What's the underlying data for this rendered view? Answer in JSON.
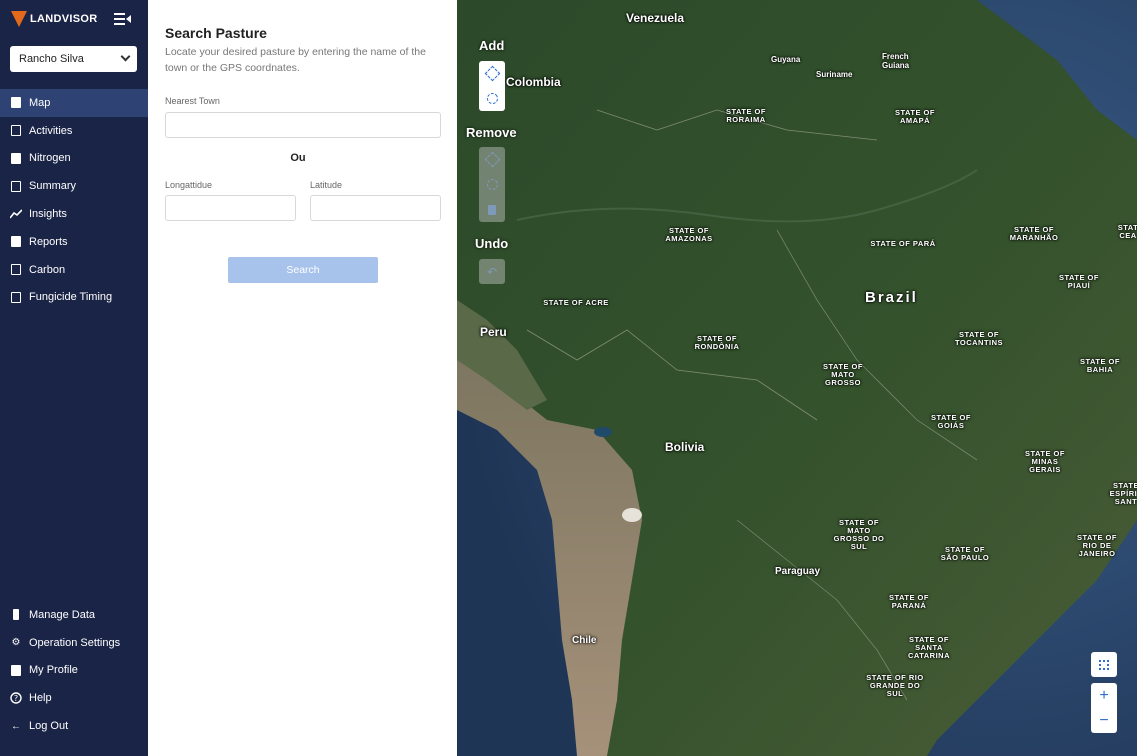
{
  "brand": {
    "name": "LANDVISOR"
  },
  "farm_select": {
    "value": "Rancho Silva"
  },
  "nav_top": [
    {
      "label": "Map",
      "icon": "map-icon",
      "active": true
    },
    {
      "label": "Activities",
      "icon": "activities-icon",
      "active": false
    },
    {
      "label": "Nitrogen",
      "icon": "nitrogen-icon",
      "active": false
    },
    {
      "label": "Summary",
      "icon": "summary-icon",
      "active": false
    },
    {
      "label": "Insights",
      "icon": "insights-icon",
      "active": false
    },
    {
      "label": "Reports",
      "icon": "reports-icon",
      "active": false
    },
    {
      "label": "Carbon",
      "icon": "carbon-icon",
      "active": false
    },
    {
      "label": "Fungicide Timing",
      "icon": "calendar-icon",
      "active": false
    }
  ],
  "nav_bottom": [
    {
      "label": "Manage Data",
      "icon": "data-icon"
    },
    {
      "label": "Operation Settings",
      "icon": "gear-icon"
    },
    {
      "label": "My Profile",
      "icon": "profile-icon"
    },
    {
      "label": "Help",
      "icon": "help-icon"
    },
    {
      "label": "Log Out",
      "icon": "logout-icon"
    }
  ],
  "panel": {
    "title": "Search Pasture",
    "description": "Locate your desired pasture by entering the name of the town or the GPS coordnates.",
    "nearest_town_label": "Nearest Town",
    "or_text": "Ou",
    "longitude_label": "Longattidue",
    "latitude_label": "Latitude",
    "search_label": "Search"
  },
  "map_tools": {
    "add_title": "Add",
    "remove_title": "Remove",
    "undo_title": "Undo"
  },
  "map_controls": {
    "zoom_in": "+",
    "zoom_out": "−"
  },
  "map_labels": {
    "venezuela": "Venezuela",
    "colombia": "Colombia",
    "guyana": "Guyana",
    "suriname": "Suriname",
    "french_guiana": "French Guiana",
    "peru": "Peru",
    "bolivia": "Bolivia",
    "brazil": "Brazil",
    "paraguay": "Paraguay",
    "chile": "Chile",
    "roraima": "STATE OF RORAIMA",
    "amapa": "STATE OF AMAPÁ",
    "amazonas": "STATE OF AMAZONAS",
    "para": "STATE OF PARÁ",
    "maranhao": "STATE OF MARANHÃO",
    "ceara": "STAT CEA",
    "piaui": "STATE OF PIAUÍ",
    "acre": "STATE OF ACRE",
    "rondonia": "STATE OF RONDÔNIA",
    "tocantins": "STATE OF TOCANTINS",
    "mato_grosso": "STATE OF MATO GROSSO",
    "bahia": "STATE OF BAHIA",
    "goias": "STATE OF GOIÁS",
    "minas": "STATE OF MINAS GERAIS",
    "espirito": "STATE ESPÍRIT SANT",
    "ms": "STATE OF MATO GROSSO DO SUL",
    "sao_paulo": "STATE OF SÃO PAULO",
    "rio": "STATE OF RIO DE JANEIRO",
    "parana": "STATE OF PARANÁ",
    "santa_catarina": "STATE OF SANTA CATARINA",
    "rio_grande": "STATE OF RIO GRANDE DO SUL"
  }
}
